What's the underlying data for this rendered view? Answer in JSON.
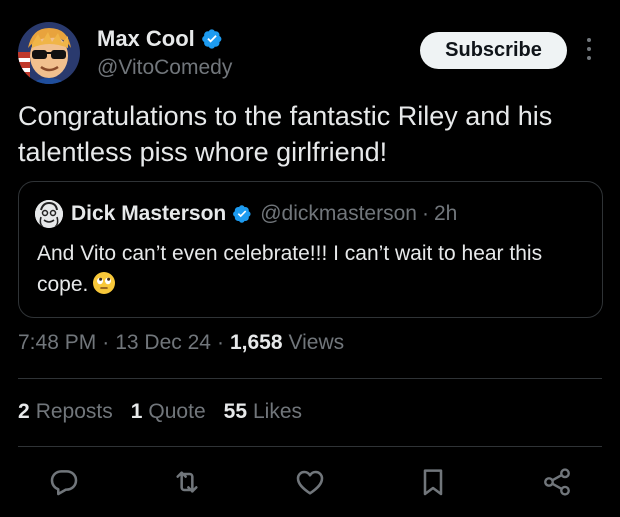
{
  "author": {
    "display_name": "Max Cool",
    "handle": "@VitoComedy",
    "verified": true,
    "avatar_icon": "cartoon-sunglasses-avatar"
  },
  "header": {
    "subscribe_label": "Subscribe",
    "more_icon": "more-vertical-icon"
  },
  "tweet": {
    "text": "Congratulations to the fantastic Riley and his talentless piss whore girlfriend!"
  },
  "quote": {
    "display_name": "Dick Masterson",
    "handle": "@dickmasterson",
    "separator": "·",
    "time": "2h",
    "text": "And Vito can’t even celebrate!!! I can’t wait to hear this cope.",
    "emoji_icon": "eye-roll-emoji"
  },
  "meta": {
    "time": "7:48 PM",
    "date": "13 Dec 24",
    "views_count": "1,658",
    "views_label": "Views",
    "separator": "·"
  },
  "stats": {
    "reposts_count": "2",
    "reposts_label": "Reposts",
    "quotes_count": "1",
    "quotes_label": "Quote",
    "likes_count": "55",
    "likes_label": "Likes"
  },
  "actions": [
    "reply-icon",
    "repost-icon",
    "like-icon",
    "bookmark-icon",
    "share-icon"
  ],
  "colors": {
    "background": "#000000",
    "text": "#e7e9ea",
    "muted": "#71767b",
    "border": "#2f3336",
    "verified": "#1d9bf0"
  }
}
